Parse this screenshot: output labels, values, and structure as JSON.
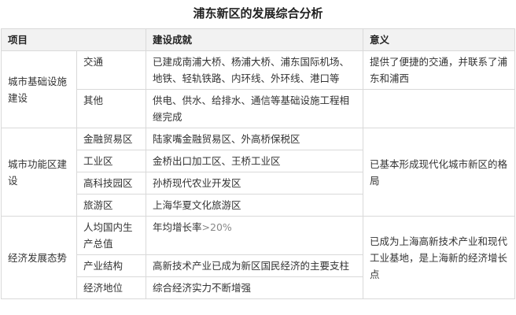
{
  "title": "浦东新区的发展综合分析",
  "headers": {
    "project": "项目",
    "achievement": "建设成就",
    "meaning": "意义"
  },
  "rows": {
    "infra": {
      "category": "城市基础设施建设",
      "meaning": "提供了便捷的交通，并联系了浦东和浦西",
      "items": [
        {
          "sub": "交通",
          "achievement": "已建成南浦大桥、杨浦大桥、浦东国际机场、地铁、轻轨铁路、内环线、外环线、港口等"
        },
        {
          "sub": "其他",
          "achievement": "供电、供水、给排水、通信等基础设施工程相继完成"
        }
      ]
    },
    "func": {
      "category": "城市功能区建设",
      "meaning": "已基本形成现代化城市新区的格局",
      "items": [
        {
          "sub": "金融贸易区",
          "achievement": "陆家嘴金融贸易区、外高桥保税区"
        },
        {
          "sub": "工业区",
          "achievement": "金桥出口加工区、王桥工业区"
        },
        {
          "sub": "高科技园区",
          "achievement": "孙桥现代农业开发区"
        },
        {
          "sub": "旅游区",
          "achievement": "上海华夏文化旅游区"
        }
      ]
    },
    "econ": {
      "category": "经济发展态势",
      "meaning": "已成为上海高新技术产业和现代工业基地，是上海新的经济增长点",
      "items": [
        {
          "sub": "人均国内生产总值",
          "achievement_prefix": "年均增长率",
          "achievement_value": ">20%"
        },
        {
          "sub": "产业结构",
          "achievement": "高新技术产业已成为新区国民经济的主要支柱"
        },
        {
          "sub": "经济地位",
          "achievement": "综合经济实力不断增强"
        }
      ]
    }
  }
}
